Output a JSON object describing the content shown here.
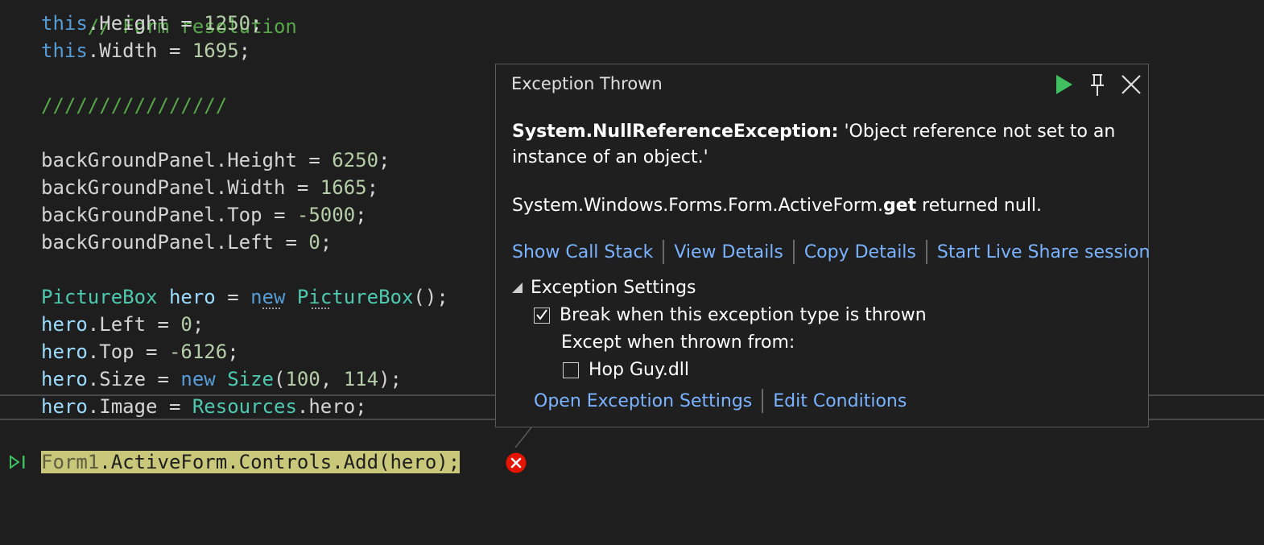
{
  "code": {
    "line0": {
      "comment": "// Form resolution"
    },
    "line1": {
      "kw": "this",
      "rest": ".Height = ",
      "num": "1250",
      "end": ";"
    },
    "line2": {
      "kw": "this",
      "rest": ".Width = ",
      "num": "1695",
      "end": ";"
    },
    "line3": {
      "comment": "////////////////"
    },
    "line4": {
      "obj": "backGroundPanel",
      "rest": ".Height = ",
      "num": "6250",
      "end": ";"
    },
    "line5": {
      "obj": "backGroundPanel",
      "rest": ".Width = ",
      "num": "1665",
      "end": ";"
    },
    "line6": {
      "obj": "backGroundPanel",
      "rest": ".Top = ",
      "num": "-5000",
      "end": ";"
    },
    "line7": {
      "obj": "backGroundPanel",
      "rest": ".Left = ",
      "num": "0",
      "end": ";"
    },
    "line8": {
      "type1": "PictureBox",
      "var": " hero",
      "eq": " = ",
      "kw": "new",
      "sp": " ",
      "type2": "PictureBox",
      "end": "();"
    },
    "line9": {
      "obj": "hero",
      "rest": ".Left = ",
      "num": "0",
      "end": ";"
    },
    "line10": {
      "obj": "hero",
      "rest": ".Top = ",
      "num": "-6126",
      "end": ";"
    },
    "line11": {
      "obj": "hero",
      "rest": ".Size = ",
      "kw": "new",
      "sp": " ",
      "type": "Size",
      "open": "(",
      "num1": "100",
      "comma": ", ",
      "num2": "114",
      "end": ");"
    },
    "line12": {
      "obj": "hero",
      "rest": ".Image = ",
      "type": "Resources",
      "tail": ".hero",
      "end": ";"
    },
    "current": {
      "faded": "Form1",
      "rest": ".ActiveForm.Controls.Add(hero);"
    }
  },
  "popup": {
    "title": "Exception Thrown",
    "exception_type": "System.NullReferenceException:",
    "exception_message": " 'Object reference not set to an instance of an object.'",
    "detail_prefix": "System.Windows.Forms.Form.ActiveForm.",
    "detail_bold": "get",
    "detail_suffix": " returned null.",
    "links": [
      "Show Call Stack",
      "View Details",
      "Copy Details",
      "Start Live Share session"
    ],
    "settings_header": "Exception Settings",
    "break_label": "Break when this exception type is thrown",
    "break_checked": true,
    "except_label": "Except when thrown from:",
    "module_label": "Hop Guy.dll",
    "module_checked": false,
    "bottom_links": [
      "Open Exception Settings",
      "Edit Conditions"
    ]
  },
  "icons": {
    "continue": "play-icon",
    "pin": "pin-icon",
    "close": "close-icon",
    "error": "error-icon",
    "exec": "execution-pointer-icon"
  },
  "colors": {
    "background": "#1e1e1e",
    "keyword": "#569cd6",
    "type": "#4ec9b0",
    "number": "#b5cea8",
    "comment": "#57a64a",
    "link": "#7ab3ff",
    "highlight": "#c8c77a",
    "error": "#e51400",
    "continue": "#3fbf5f"
  }
}
